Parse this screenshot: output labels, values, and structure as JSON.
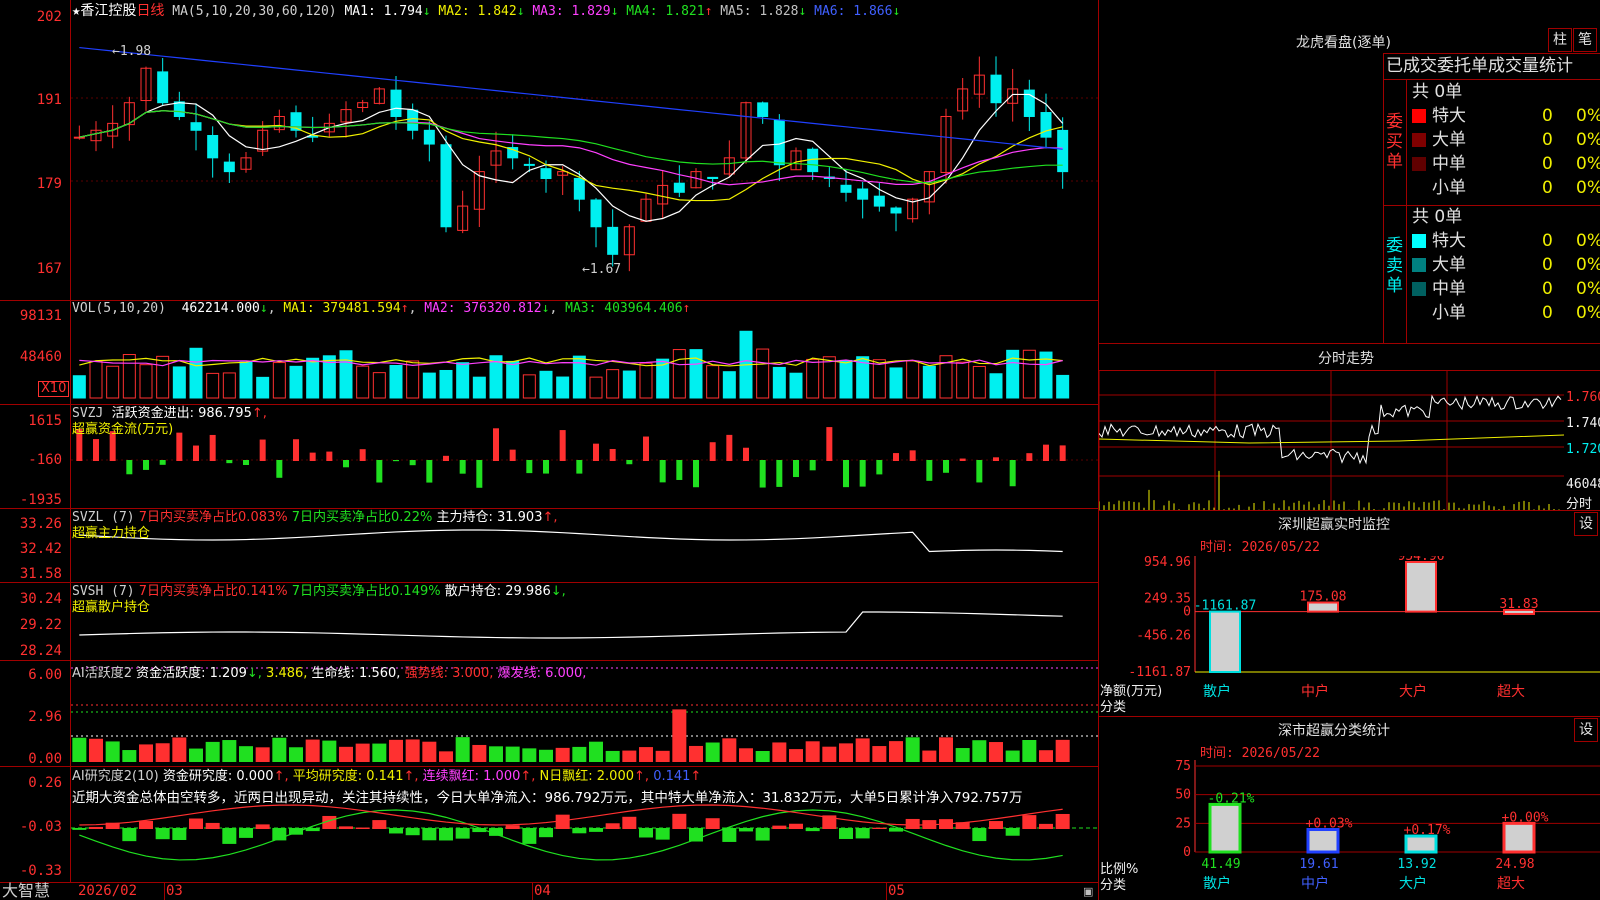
{
  "stock": {
    "name": "★香江控股",
    "period": "日线"
  },
  "colors": {
    "up": "#ff3030",
    "down": "#00f0f0",
    "grid": "#a00000",
    "ma1": "#ffffff",
    "ma2": "#f0f000",
    "ma3": "#ff40ff",
    "ma4": "#20e020",
    "ma5": "#909090",
    "ma6": "#2040ff"
  },
  "price_panel": {
    "label": "MA(5,10,20,30,60,120)",
    "ma": [
      {
        "label": "MA1: 1.794",
        "arrow": "↓"
      },
      {
        "label": "MA2: 1.842",
        "arrow": "↓"
      },
      {
        "label": "MA3: 1.829",
        "arrow": "↓"
      },
      {
        "label": "MA4: 1.821",
        "arrow": "↑"
      },
      {
        "label": "MA5: 1.828",
        "arrow": "↓"
      },
      {
        "label": "MA6: 1.866",
        "arrow": "↓"
      }
    ],
    "y_ticks": [
      "202",
      "191",
      "179",
      "167"
    ],
    "high_note": "←1.98",
    "low_note": "←1.67"
  },
  "vol_panel": {
    "label": "VOL(5,10,20)",
    "value": "462214.000",
    "value_arrow": "↓",
    "ma1": "MA1: 379481.594",
    "ma1_arrow": "↑",
    "ma2": "MA2: 376320.812",
    "ma2_arrow": "↓",
    "ma3": "MA3: 403964.406",
    "ma3_arrow": "↑",
    "y_ticks": [
      "98131",
      "48460"
    ],
    "unit": "X10"
  },
  "svzj_panel": {
    "label": "SVZJ",
    "text": "活跃资金进出: 986.795",
    "arrow": "↑,",
    "subtitle": "超赢资金流(万元)",
    "y_ticks": [
      "1615",
      "-160",
      "-1935"
    ]
  },
  "svzl_panel": {
    "label": "SVZL (7)",
    "t1": "7日内买卖净占比0.083%",
    "t2": "7日内买卖净占比0.22%",
    "t3": "主力持仓: 31.903",
    "arrow": "↑,",
    "subtitle": "超赢主力持仓",
    "y_ticks": [
      "33.26",
      "32.42",
      "31.58"
    ]
  },
  "svsh_panel": {
    "label": "SVSH (7)",
    "t1": "7日内买卖净占比0.141%",
    "t2": "7日内买卖净占比0.149%",
    "t3": "散户持仓: 29.986",
    "arrow": "↓,",
    "subtitle": "超赢散户持仓",
    "y_ticks": [
      "30.24",
      "29.22",
      "28.24"
    ]
  },
  "ai_active_panel": {
    "label": "AI活跃度2",
    "t1": "资金活跃度: 1.209",
    "t1_arrow": "↓,",
    "t2": "3.486,",
    "t3": "生命线: 1.560,",
    "t4": "强势线: 3.000,",
    "t5": "爆发线: 6.000,",
    "y_ticks": [
      "6.00",
      "2.96",
      "0.00"
    ]
  },
  "ai_research_panel": {
    "label": "AI研究度2(10)",
    "t1": "资金研究度: 0.000",
    "t1_arrow": "↑,",
    "t2": "平均研究度: 0.141",
    "t2_arrow": "↑,",
    "t3": "连续飘红: 1.000",
    "t3_arrow": "↑,",
    "t4": "N日飘红: 2.000",
    "t4_arrow": "↑,",
    "t5": "0.141",
    "t5_arrow": "↑",
    "comment": "近期大资金总体由空转多，近两日出现异动，关注其持续性，今日大单净流入：986.792万元，其中特大单净流入：31.832万元，大单5日累计净入792.757万",
    "y_ticks": [
      "0.26",
      "-0.03",
      "-0.33"
    ]
  },
  "date_axis": {
    "brand": "大智慧",
    "labels": [
      "2026/02",
      "03",
      "04",
      "05"
    ]
  },
  "right_panel": {
    "lhb_title": "龙虎看盘(逐单)",
    "btn1": "柱",
    "btn2": "笔",
    "header": "已成交委托单成交量统计",
    "buy": {
      "side": "委买单",
      "total": "共 0单",
      "rows": [
        {
          "label": "特大",
          "count": "0",
          "pct": "0%",
          "color": "#ff0000"
        },
        {
          "label": "大单",
          "count": "0",
          "pct": "0%",
          "color": "#800000"
        },
        {
          "label": "中单",
          "count": "0",
          "pct": "0%",
          "color": "#600000"
        },
        {
          "label": "小单",
          "count": "0",
          "pct": "0%",
          "color": "#000000"
        }
      ]
    },
    "sell": {
      "side": "委卖单",
      "total": "共 0单",
      "rows": [
        {
          "label": "特大",
          "count": "0",
          "pct": "0%",
          "color": "#00ffff"
        },
        {
          "label": "大单",
          "count": "0",
          "pct": "0%",
          "color": "#008080"
        },
        {
          "label": "中单",
          "count": "0",
          "pct": "0%",
          "color": "#006060"
        },
        {
          "label": "小单",
          "count": "0",
          "pct": "0%",
          "color": "#000000"
        }
      ]
    },
    "intraday_title": "分时走势",
    "intraday_y": [
      "1.760",
      "1.740",
      "1.720"
    ],
    "intraday_vol": "46048",
    "intraday_vol_unit": "分时",
    "monitor": {
      "title": "深圳超赢实时监控",
      "settings": "设",
      "time": "时间: 2026/05/22",
      "y_ticks": [
        "954.96",
        "249.35",
        "0",
        "-456.26",
        "-1161.87"
      ],
      "axis_label1": "净额(万元)",
      "axis_label2": "分类",
      "categories": [
        "散户",
        "中户",
        "大户",
        "超大"
      ],
      "values": [
        -1161.87,
        175.08,
        954.96,
        31.83
      ],
      "value_labels": [
        "-1161.87",
        "175.08",
        "954.96",
        "31.83"
      ]
    },
    "classify": {
      "title": "深市超赢分类统计",
      "settings": "设",
      "time": "时间: 2026/05/22",
      "y_ticks": [
        "75",
        "50",
        "25",
        "0"
      ],
      "axis_label1": "比例%",
      "axis_label2": "分类",
      "categories": [
        "散户",
        "中户",
        "大户",
        "超大"
      ],
      "values": [
        41.49,
        19.61,
        13.92,
        24.98
      ],
      "value_labels": [
        "41.49",
        "19.61",
        "13.92",
        "24.98"
      ],
      "changes": [
        "-0.21%",
        "+0.03%",
        "+0.17%",
        "+0.00%"
      ]
    }
  }
}
